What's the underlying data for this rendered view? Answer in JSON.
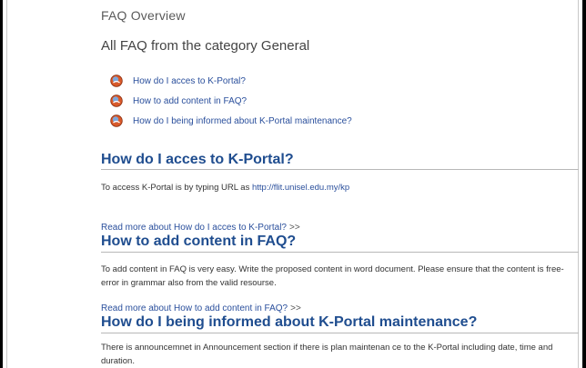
{
  "page": {
    "title": "FAQ Overview",
    "category_heading": "All FAQ from the category General"
  },
  "faq_list": [
    {
      "label": "How do I acces to K-Portal?"
    },
    {
      "label": "How to add content in FAQ?"
    },
    {
      "label": "How do I being informed about K-Portal maintenance?"
    }
  ],
  "sections": [
    {
      "title": "How do I acces to K-Portal?",
      "text": "To access K-Portal is by typing URL as ",
      "link": "http://flit.unisel.edu.my/kp",
      "read_more": "Read more about How do I acces to K-Portal?"
    },
    {
      "title": "How to add content in FAQ?",
      "text": "To add content in FAQ is very easy. Write the proposed content in word document. Please ensure that the content is free-error in grammar also from the valid resourse.",
      "read_more": "Read more about How to add content in FAQ?"
    },
    {
      "title": "How do I being informed about K-Portal maintenance?",
      "text": "There is announcemnet in Announcement section if there is plan maintenan ce to the K-Portal including date, time and duration."
    }
  ],
  "read_more_arrows": ">>",
  "icons": {
    "faq_bullet": "faq-bullet-icon"
  },
  "colors": {
    "heading_blue": "#1f4d8f",
    "link_blue": "#2a4f9c"
  }
}
